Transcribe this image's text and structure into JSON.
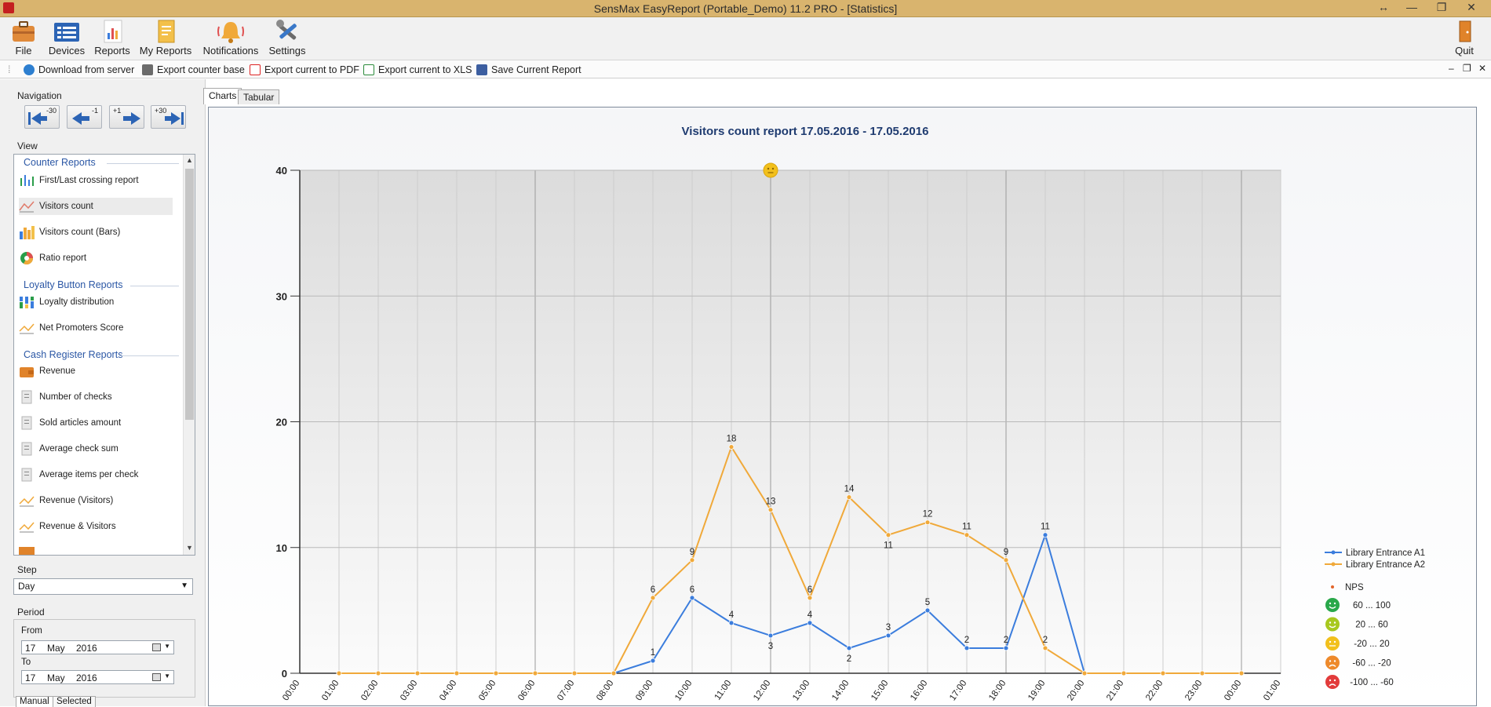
{
  "window": {
    "title": "SensMax EasyReport (Portable_Demo) 11.2 PRO - [Statistics]",
    "controls": [
      "↔",
      "—",
      "❐",
      "✕"
    ]
  },
  "ribbon": {
    "file": "File",
    "devices": "Devices",
    "reports": "Reports",
    "my_reports": "My Reports",
    "notifications": "Notifications",
    "settings": "Settings",
    "quit": "Quit"
  },
  "toolbar": {
    "download": "Download from server",
    "export_base": "Export counter base",
    "export_pdf": "Export current to PDF",
    "export_xls": "Export current to XLS",
    "save_report": "Save Current Report",
    "child_controls": [
      "–",
      "❐",
      "✕"
    ]
  },
  "left": {
    "navigation_label": "Navigation",
    "nav_buttons": [
      "-30",
      "-1",
      "+1",
      "+30"
    ],
    "view_label": "View",
    "sections": {
      "counter": "Counter Reports",
      "loyalty": "Loyalty Button Reports",
      "cash": "Cash Register Reports"
    },
    "items": [
      "First/Last crossing report",
      "Visitors count",
      "Visitors count (Bars)",
      "Ratio report",
      "Loyalty distribution",
      "Net Promoters Score",
      "Revenue",
      "Number of checks",
      "Sold articles amount",
      "Average check sum",
      "Average items per check",
      "Revenue (Visitors)",
      "Revenue & Visitors"
    ],
    "step_label": "Step",
    "step_value": "Day",
    "period_label": "Period",
    "from_label": "From",
    "to_label": "To",
    "from_date": {
      "day": "17",
      "month": "May",
      "year": "2016"
    },
    "to_date": {
      "day": "17",
      "month": "May",
      "year": "2016"
    },
    "bottom_tabs": [
      "Manual",
      "Selected"
    ]
  },
  "tabs": {
    "charts": "Charts",
    "tabular": "Tabular"
  },
  "chart_data": {
    "type": "line",
    "title": "Visitors count report 17.05.2016 - 17.05.2016",
    "xlabel": "",
    "ylabel": "",
    "ylim": [
      0,
      40
    ],
    "yticks": [
      "0",
      "10",
      "20",
      "30",
      "40"
    ],
    "grid": true,
    "legend_position": "right",
    "categories": [
      "00:00",
      "01:00",
      "02:00",
      "03:00",
      "04:00",
      "05:00",
      "06:00",
      "07:00",
      "08:00",
      "09:00",
      "10:00",
      "11:00",
      "12:00",
      "13:00",
      "14:00",
      "15:00",
      "16:00",
      "17:00",
      "18:00",
      "19:00",
      "20:00",
      "21:00",
      "22:00",
      "23:00",
      "00:00",
      "01:00"
    ],
    "series": [
      {
        "name": "Library Entrance A1",
        "color": "#3b7ddd",
        "values": [
          null,
          0,
          0,
          0,
          0,
          0,
          0,
          0,
          0,
          1,
          6,
          4,
          3,
          4,
          2,
          3,
          5,
          2,
          2,
          11,
          0,
          0,
          0,
          0,
          0,
          null
        ]
      },
      {
        "name": "Library Entrance A2",
        "color": "#f0a93a",
        "values": [
          null,
          0,
          0,
          0,
          0,
          0,
          0,
          0,
          0,
          6,
          9,
          18,
          13,
          6,
          14,
          11,
          12,
          11,
          9,
          2,
          0,
          0,
          0,
          0,
          0,
          null
        ]
      }
    ],
    "nps_marker": {
      "category": "12:00",
      "value": 40
    },
    "nps_legend": {
      "title": "NPS",
      "ranges": [
        {
          "label": "60 ... 100",
          "color": "#29a84a"
        },
        {
          "label": "20 ... 60",
          "color": "#a8c81e"
        },
        {
          "label": "-20 ... 20",
          "color": "#f2c01c"
        },
        {
          "label": "-60 ... -20",
          "color": "#ee8a2b"
        },
        {
          "label": "-100 ... -60",
          "color": "#e23b3b"
        }
      ]
    }
  }
}
